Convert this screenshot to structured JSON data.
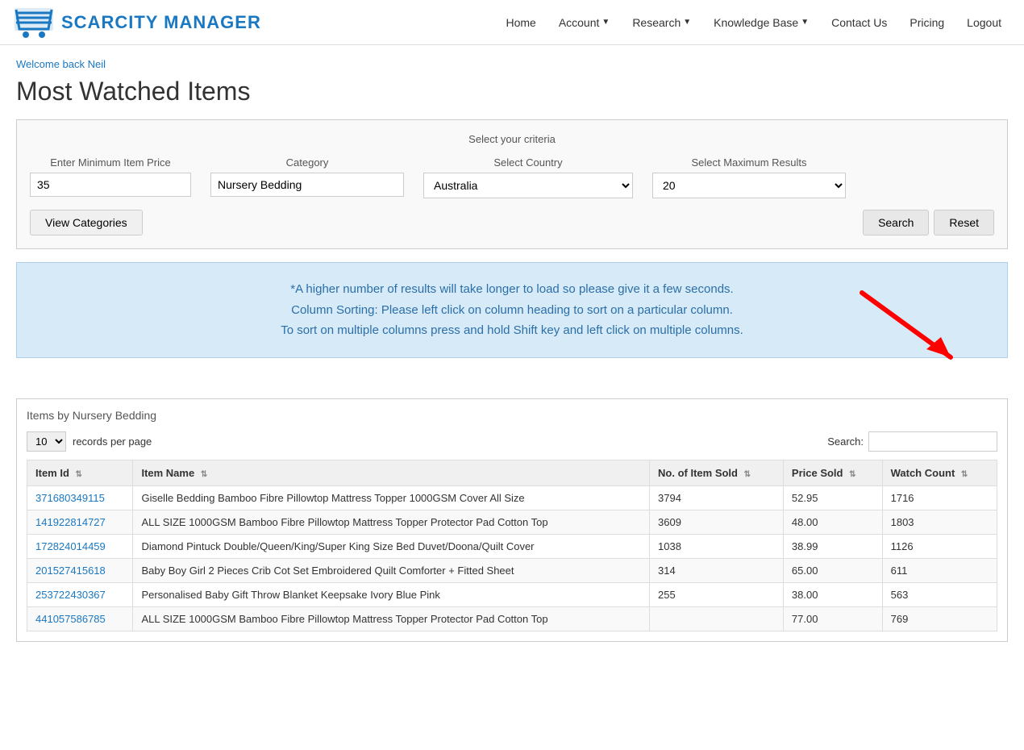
{
  "nav": {
    "logo_text": "SCARCITY MANAGER",
    "links": [
      {
        "label": "Home",
        "has_arrow": false,
        "name": "home"
      },
      {
        "label": "Account",
        "has_arrow": true,
        "name": "account"
      },
      {
        "label": "Research",
        "has_arrow": true,
        "name": "research"
      },
      {
        "label": "Knowledge Base",
        "has_arrow": true,
        "name": "knowledge-base"
      },
      {
        "label": "Contact Us",
        "has_arrow": false,
        "name": "contact-us"
      },
      {
        "label": "Pricing",
        "has_arrow": false,
        "name": "pricing"
      },
      {
        "label": "Logout",
        "has_arrow": false,
        "name": "logout"
      }
    ]
  },
  "welcome": "Welcome back Neil",
  "page_title": "Most Watched Items",
  "criteria": {
    "section_title": "Select your criteria",
    "min_price_label": "Enter Minimum Item Price",
    "min_price_value": "35",
    "category_label": "Category",
    "category_value": "Nursery Bedding",
    "country_label": "Select Country",
    "country_value": "Australia",
    "max_results_label": "Select Maximum Results",
    "max_results_value": "20",
    "view_categories_btn": "View Categories",
    "search_btn": "Search",
    "reset_btn": "Reset"
  },
  "info": {
    "line1": "*A higher number of results will take longer to load so please give it a few seconds.",
    "line2": "Column Sorting: Please left click on column heading to sort on a particular column.",
    "line3": "To sort on multiple columns press and hold Shift key and left click on multiple columns."
  },
  "table": {
    "section_title": "Items by Nursery Bedding",
    "records_per_page_label": "records per page",
    "records_per_page_value": "10",
    "search_label": "Search:",
    "search_placeholder": "",
    "columns": [
      {
        "label": "Item Id",
        "name": "item-id"
      },
      {
        "label": "Item Name",
        "name": "item-name"
      },
      {
        "label": "No. of Item Sold",
        "name": "items-sold"
      },
      {
        "label": "Price Sold",
        "name": "price-sold"
      },
      {
        "label": "Watch Count",
        "name": "watch-count"
      }
    ],
    "rows": [
      {
        "id": "371680349115",
        "name": "Giselle Bedding Bamboo Fibre Pillowtop Mattress Topper 1000GSM Cover All Size",
        "sold": "3794",
        "price": "52.95",
        "watch": "1716"
      },
      {
        "id": "141922814727",
        "name": "ALL SIZE 1000GSM Bamboo Fibre Pillowtop Mattress Topper Protector Pad Cotton Top",
        "sold": "3609",
        "price": "48.00",
        "watch": "1803"
      },
      {
        "id": "172824014459",
        "name": "Diamond Pintuck Double/Queen/King/Super King Size Bed Duvet/Doona/Quilt Cover",
        "sold": "1038",
        "price": "38.99",
        "watch": "1126"
      },
      {
        "id": "201527415618",
        "name": "Baby Boy Girl 2 Pieces Crib Cot Set Embroidered Quilt Comforter + Fitted Sheet",
        "sold": "314",
        "price": "65.00",
        "watch": "611"
      },
      {
        "id": "253722430367",
        "name": "Personalised Baby Gift Throw Blanket Keepsake Ivory Blue Pink",
        "sold": "255",
        "price": "38.00",
        "watch": "563"
      },
      {
        "id": "441057586785",
        "name": "ALL SIZE 1000GSM Bamboo Fibre Pillowtop Mattress Topper Protector Pad Cotton Top",
        "sold": "",
        "price": "77.00",
        "watch": "769"
      }
    ]
  }
}
